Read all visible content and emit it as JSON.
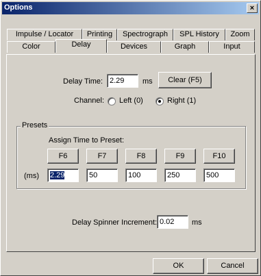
{
  "window": {
    "title": "Options",
    "close_glyph": "×"
  },
  "tabs": {
    "row1": [
      "Impulse / Locator",
      "Printing",
      "Spectrograph",
      "SPL History",
      "Zoom"
    ],
    "row2": [
      "Color",
      "Delay",
      "Devices",
      "Graph",
      "Input"
    ],
    "active": "Delay"
  },
  "delay": {
    "time_label": "Delay Time:",
    "time_value": "2.29",
    "time_unit": "ms",
    "clear_button": "Clear (F5)",
    "channel_label": "Channel:",
    "channel_left": "Left (0)",
    "channel_right": "Right (1)",
    "channel_selected": "right"
  },
  "presets": {
    "group_title": "Presets",
    "assign_label": "Assign Time to Preset:",
    "unit_label": "(ms)",
    "keys": [
      "F6",
      "F7",
      "F8",
      "F9",
      "F10"
    ],
    "values": [
      "2.29",
      "50",
      "100",
      "250",
      "500"
    ]
  },
  "spinner": {
    "label": "Delay Spinner Increment:",
    "value": "0.02",
    "unit": "ms"
  },
  "footer": {
    "ok": "OK",
    "cancel": "Cancel"
  }
}
